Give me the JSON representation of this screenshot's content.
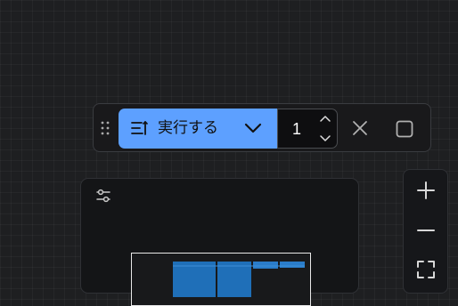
{
  "toolbar": {
    "run_label": "実行する",
    "count_value": "1"
  },
  "icons": {
    "drag": "drag-handle-icon",
    "run": "list-run-icon",
    "chevron": "chevron-down-icon",
    "stepper_up": "chevron-up-icon",
    "stepper_down": "chevron-down-icon",
    "close": "close-icon",
    "square": "square-icon",
    "settings": "sliders-icon",
    "zoom_in": "plus-icon",
    "zoom_out": "minus-icon",
    "fit": "fit-view-icon"
  },
  "colors": {
    "accent": "#5da0ff",
    "canvas": "#1e1f21",
    "preview_block": "#1f6fb8"
  }
}
